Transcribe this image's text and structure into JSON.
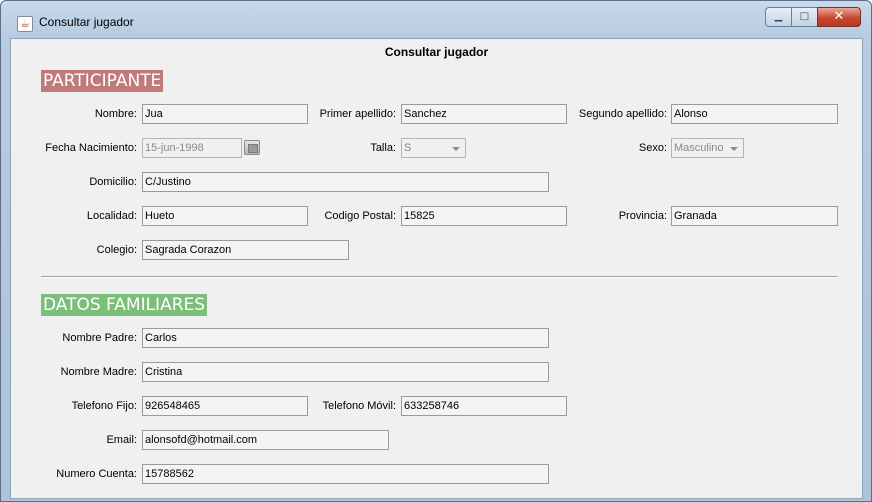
{
  "window": {
    "title": "Consultar jugador",
    "icon": "java-icon",
    "controls": {
      "minimize": "▁",
      "maximize": "□",
      "close": "✕"
    }
  },
  "form": {
    "title": "Consultar jugador",
    "participante": {
      "section_title": "PARTICIPANTE",
      "nombre": {
        "label": "Nombre:",
        "value": "Jua"
      },
      "primer_apellido": {
        "label": "Primer apellido:",
        "value": "Sanchez"
      },
      "segundo_apellido": {
        "label": "Segundo apellido:",
        "value": "Alonso"
      },
      "fecha_nacimiento": {
        "label": "Fecha Nacimiento:",
        "value": "15-jun-1998"
      },
      "talla": {
        "label": "Talla:",
        "value": "S"
      },
      "sexo": {
        "label": "Sexo:",
        "value": "Masculino"
      },
      "domicilio": {
        "label": "Domicilio:",
        "value": "C/Justino"
      },
      "localidad": {
        "label": "Localidad:",
        "value": "Hueto"
      },
      "codigo_postal": {
        "label": "Codigo Postal:",
        "value": "15825"
      },
      "provincia": {
        "label": "Provincia:",
        "value": "Granada"
      },
      "colegio": {
        "label": "Colegio:",
        "value": "Sagrada Corazon"
      }
    },
    "familiares": {
      "section_title": "DATOS FAMILIARES",
      "nombre_padre": {
        "label": "Nombre Padre:",
        "value": "Carlos"
      },
      "nombre_madre": {
        "label": "Nombre Madre:",
        "value": "Cristina"
      },
      "telefono_fijo": {
        "label": "Telefono Fijo:",
        "value": "926548465"
      },
      "telefono_movil": {
        "label": "Telefono Móvil:",
        "value": "633258746"
      },
      "email": {
        "label": "Email:",
        "value": "alonsofd@hotmail.com"
      },
      "numero_cuenta": {
        "label": "Numero Cuenta:",
        "value": "15788562"
      }
    }
  },
  "colors": {
    "participante_header": "#c07a7a",
    "familiares_header": "#7bbf7b",
    "close_button": "#c9472f"
  }
}
